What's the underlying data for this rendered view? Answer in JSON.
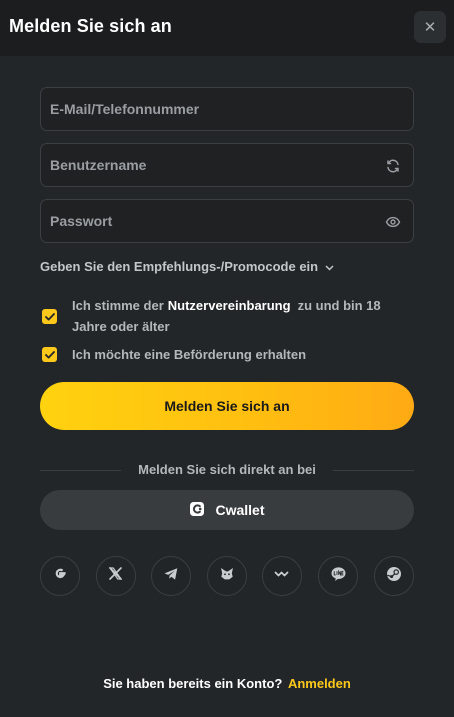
{
  "header": {
    "title": "Melden Sie sich an",
    "close_icon": "close-icon"
  },
  "form": {
    "email_placeholder": "E-Mail/Telefonnummer",
    "username_placeholder": "Benutzername",
    "password_placeholder": "Passwort",
    "promo_label": "Geben Sie den Empfehlungs-/Promocode ein",
    "terms_prefix": "Ich stimme der",
    "terms_link": "Nutzervereinbarung",
    "terms_suffix": "zu und bin 18 Jahre oder älter",
    "terms_checked": true,
    "promo_opt_in": "Ich möchte eine Beförderung erhalten",
    "promo_opt_in_checked": true,
    "submit_label": "Melden Sie sich an"
  },
  "alt_login": {
    "divider_text": "Melden Sie sich direkt an bei",
    "cwallet_label": "Cwallet",
    "providers": [
      "google-icon",
      "x-icon",
      "telegram-icon",
      "metamask-icon",
      "walletconnect-icon",
      "line-icon",
      "steam-icon"
    ]
  },
  "footer": {
    "question": "Sie haben bereits ein Konto?",
    "link": "Anmelden"
  },
  "colors": {
    "accent": "#fcc81b",
    "background": "#232628",
    "header": "#1b1d1e"
  }
}
